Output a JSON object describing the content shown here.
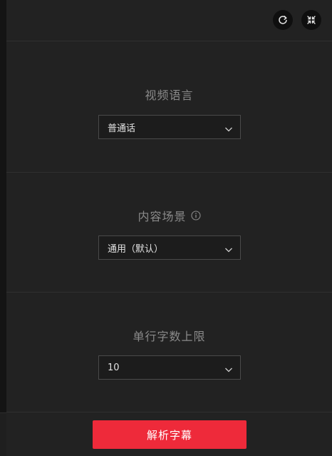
{
  "header": {
    "refresh_icon": "refresh-icon",
    "collapse_icon": "collapse-icon"
  },
  "sections": [
    {
      "label": "视频语言",
      "value": "普通话"
    },
    {
      "label": "内容场景",
      "value": "通用（默认）",
      "has_info": true
    },
    {
      "label": "单行字数上限",
      "value": "10"
    }
  ],
  "footer": {
    "primary_label": "解析字幕"
  },
  "colors": {
    "panel_bg": "#222222",
    "accent": "#ee2a3a",
    "label_text": "#8a8a8a",
    "value_text": "#e2e2e2"
  }
}
